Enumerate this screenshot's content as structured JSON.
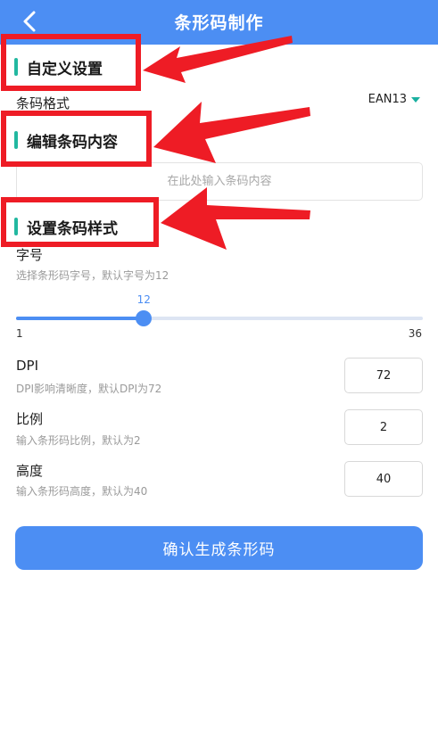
{
  "header": {
    "title": "条形码制作",
    "back_icon": "chevron-left-icon"
  },
  "sections": {
    "custom": "自定义设置",
    "content": "编辑条码内容",
    "style": "设置条码样式"
  },
  "format": {
    "label": "条码格式",
    "value": "EAN13"
  },
  "content_input": {
    "value": "",
    "placeholder": "在此处输入条码内容"
  },
  "font_size": {
    "label": "字号",
    "hint": "选择条形码字号，默认字号为12",
    "value": "12",
    "min": "1",
    "max": "36",
    "value_num": 12,
    "min_num": 1,
    "max_num": 36
  },
  "dpi": {
    "label": "DPI",
    "hint": "DPI影响清晰度，默认DPI为72",
    "value": "72"
  },
  "ratio": {
    "label": "比例",
    "hint": "输入条形码比例，默认为2",
    "value": "2"
  },
  "height": {
    "label": "高度",
    "hint": "输入条形码高度，默认为40",
    "value": "40"
  },
  "submit_label": "确认生成条形码",
  "colors": {
    "primary": "#4c8ef3",
    "accent_bar": "#22b8a0",
    "annotation_red": "#ee1c25"
  }
}
